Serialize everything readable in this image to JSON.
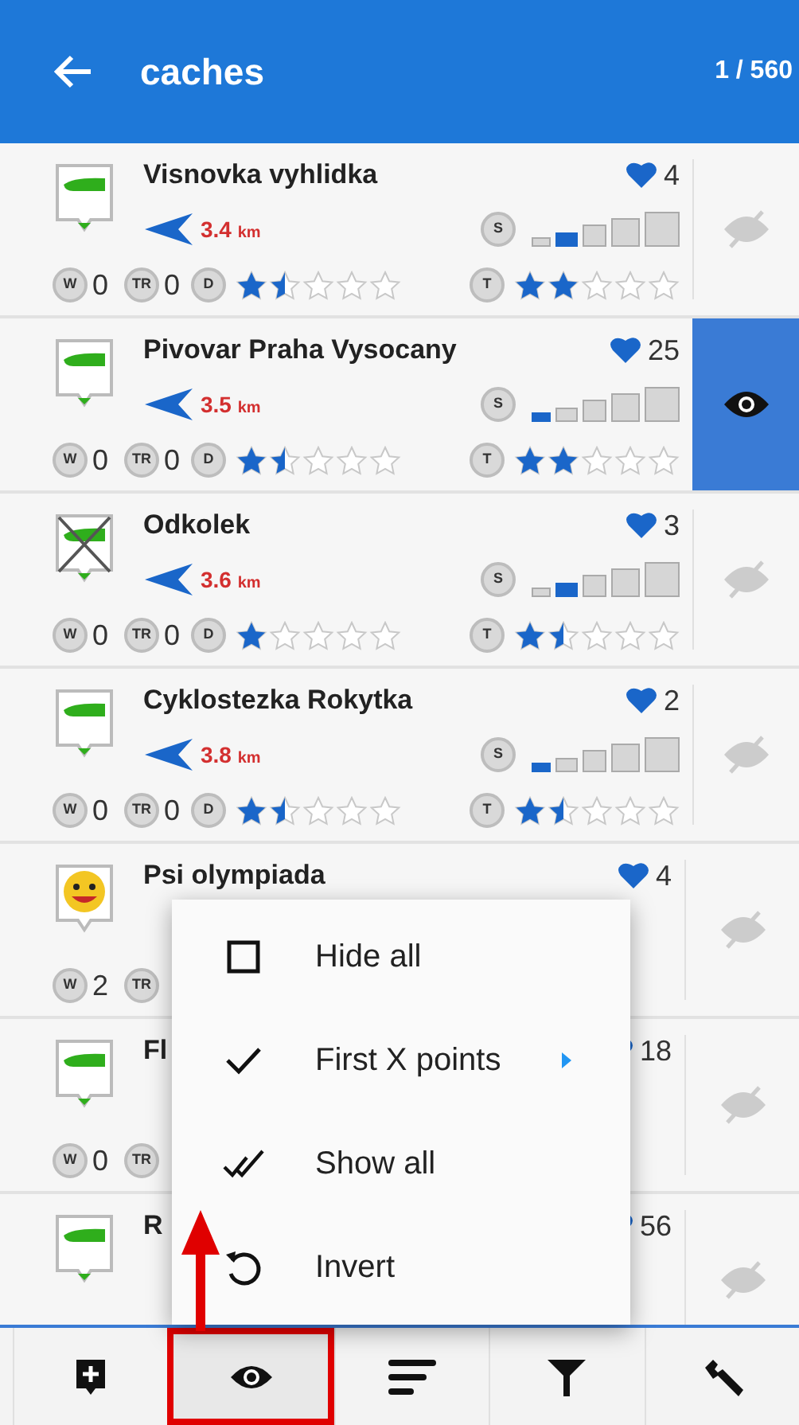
{
  "header": {
    "title": "caches",
    "count": "1 / 560"
  },
  "rows": [
    {
      "name": "Visnovka vyhlidka",
      "kind": "traditional",
      "distance": "3.4",
      "unit": "km",
      "favorites": "4",
      "size_label": "S",
      "size": [
        {
          "selected": false
        },
        {
          "selected": true
        },
        {
          "selected": false
        },
        {
          "selected": false
        },
        {
          "selected": false
        }
      ],
      "waypoints": {
        "label": "W",
        "value": "0"
      },
      "trackables": {
        "label": "TR",
        "value": "0"
      },
      "difficulty": {
        "label": "D",
        "stars": 1.5
      },
      "terrain": {
        "label": "T",
        "stars": 2
      },
      "visible": false
    },
    {
      "name": "Pivovar Praha Vysocany",
      "kind": "traditional",
      "distance": "3.5",
      "unit": "km",
      "favorites": "25",
      "size_label": "S",
      "size": [
        {
          "selected": true
        },
        {
          "selected": false
        },
        {
          "selected": false
        },
        {
          "selected": false
        },
        {
          "selected": false
        }
      ],
      "waypoints": {
        "label": "W",
        "value": "0"
      },
      "trackables": {
        "label": "TR",
        "value": "0"
      },
      "difficulty": {
        "label": "D",
        "stars": 1.5
      },
      "terrain": {
        "label": "T",
        "stars": 2
      },
      "visible": true
    },
    {
      "name": "Odkolek",
      "kind": "disabled",
      "distance": "3.6",
      "unit": "km",
      "favorites": "3",
      "size_label": "S",
      "size": [
        {
          "selected": false
        },
        {
          "selected": true
        },
        {
          "selected": false
        },
        {
          "selected": false
        },
        {
          "selected": false
        }
      ],
      "waypoints": {
        "label": "W",
        "value": "0"
      },
      "trackables": {
        "label": "TR",
        "value": "0"
      },
      "difficulty": {
        "label": "D",
        "stars": 1
      },
      "terrain": {
        "label": "T",
        "stars": 1.5
      },
      "visible": false
    },
    {
      "name": "Cyklostezka Rokytka",
      "kind": "traditional",
      "distance": "3.8",
      "unit": "km",
      "favorites": "2",
      "size_label": "S",
      "size": [
        {
          "selected": true
        },
        {
          "selected": false
        },
        {
          "selected": false
        },
        {
          "selected": false
        },
        {
          "selected": false
        }
      ],
      "waypoints": {
        "label": "W",
        "value": "0"
      },
      "trackables": {
        "label": "TR",
        "value": "0"
      },
      "difficulty": {
        "label": "D",
        "stars": 1.5
      },
      "terrain": {
        "label": "T",
        "stars": 1.5
      },
      "visible": false
    },
    {
      "name": "Psi olympiada",
      "kind": "event",
      "favorites": "4",
      "waypoints": {
        "label": "W",
        "value": "2"
      },
      "trackables": {
        "label": "TR"
      },
      "visible": false
    },
    {
      "name": "Fl",
      "kind": "traditional",
      "favorites": "18",
      "waypoints": {
        "label": "W",
        "value": "0"
      },
      "trackables": {
        "label": "TR"
      },
      "visible": false
    },
    {
      "name": "R",
      "kind": "traditional",
      "favorites": "56",
      "visible": false
    }
  ],
  "menu": {
    "items": [
      {
        "kind": "hide",
        "label": "Hide all",
        "submenu": false
      },
      {
        "kind": "first",
        "label": "First X points",
        "submenu": true
      },
      {
        "kind": "show",
        "label": "Show all",
        "submenu": false
      },
      {
        "kind": "invert",
        "label": "Invert",
        "submenu": false
      }
    ]
  },
  "bottom_bar": {
    "items": [
      {
        "kind": "add",
        "highlighted": false
      },
      {
        "kind": "visibility",
        "highlighted": true
      },
      {
        "kind": "sort",
        "highlighted": false
      },
      {
        "kind": "filter",
        "highlighted": false
      },
      {
        "kind": "tools",
        "highlighted": false
      }
    ]
  },
  "callout_arrow": true
}
